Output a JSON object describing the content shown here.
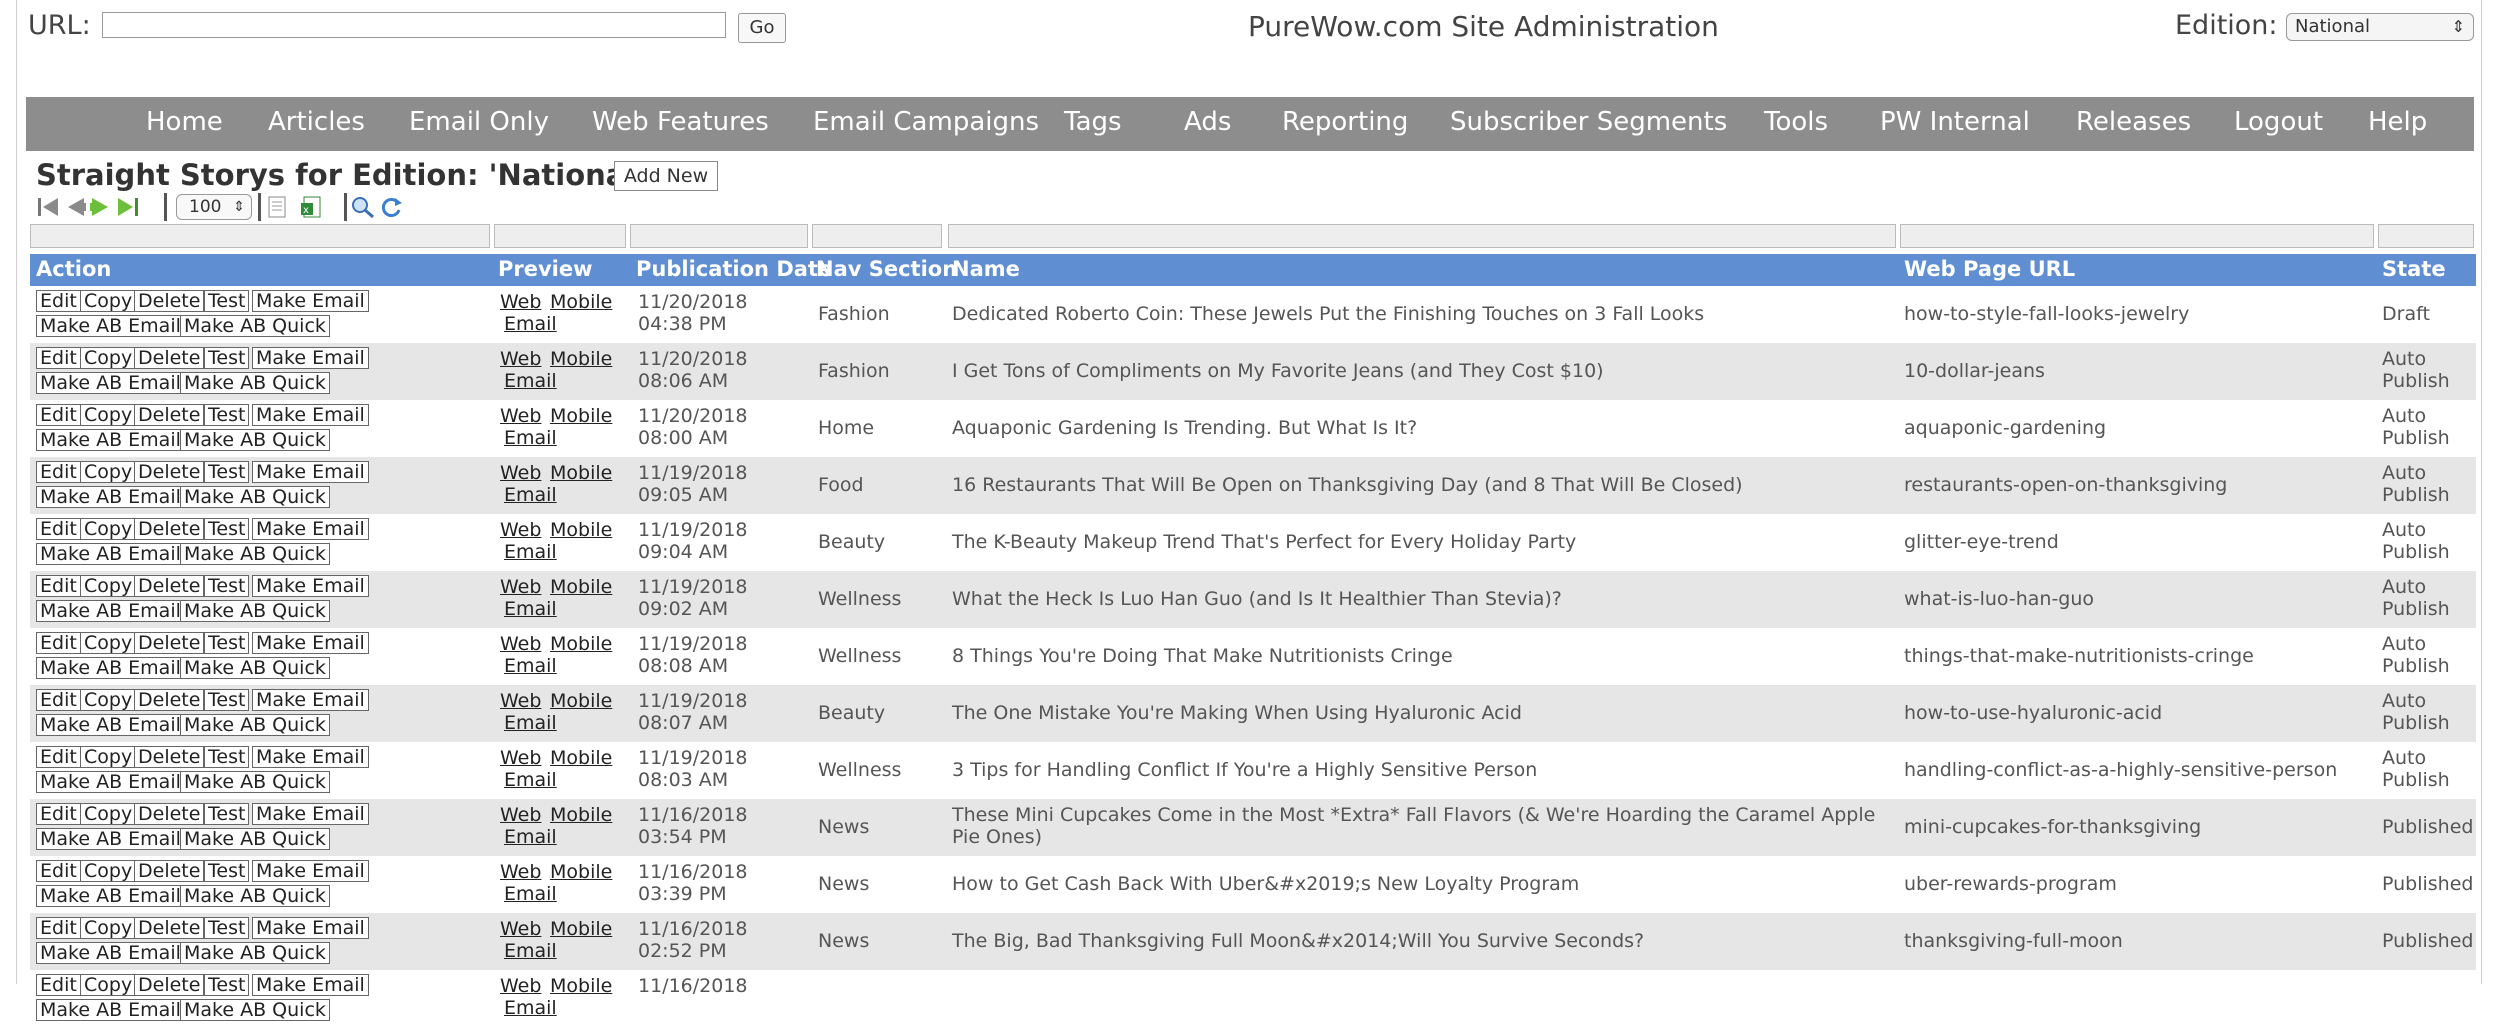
{
  "top": {
    "url_label": "URL:",
    "url_value": "",
    "go_label": "Go",
    "site_title": "PureWow.com Site Administration",
    "edition_label": "Edition:",
    "edition_value": "National"
  },
  "nav": {
    "items": [
      "Home",
      "Articles",
      "Email Only",
      "Web Features",
      "Email Campaigns",
      "Tags",
      "Ads",
      "Reporting",
      "Subscriber Segments",
      "Tools",
      "PW Internal",
      "Releases",
      "Logout",
      "Help"
    ]
  },
  "page": {
    "heading": "Straight Storys for Edition: 'National'",
    "add_new_label": "Add New",
    "page_size": "100"
  },
  "table": {
    "columns": [
      "Action",
      "Preview",
      "Publication Date",
      "Nav Section",
      "Name",
      "Web Page URL",
      "State"
    ],
    "action_labels": [
      "Edit",
      "Copy",
      "Delete",
      "Test",
      "Make Email",
      "Make AB Email",
      "Make AB Quick"
    ],
    "preview_labels": [
      "Web",
      "Mobile",
      "Email"
    ],
    "rows": [
      {
        "date": "11/20/2018",
        "time": "04:38 PM",
        "section": "Fashion",
        "name": "Dedicated Roberto Coin: These Jewels Put the Finishing Touches on 3 Fall Looks",
        "url": "how-to-style-fall-looks-jewelry",
        "state": "Draft"
      },
      {
        "date": "11/20/2018",
        "time": "08:06 AM",
        "section": "Fashion",
        "name": "I Get Tons of Compliments on My Favorite Jeans (and They Cost $10)",
        "url": "10-dollar-jeans",
        "state": "Auto Publish"
      },
      {
        "date": "11/20/2018",
        "time": "08:00 AM",
        "section": "Home",
        "name": "Aquaponic Gardening Is Trending. But What Is It?",
        "url": "aquaponic-gardening",
        "state": "Auto Publish"
      },
      {
        "date": "11/19/2018",
        "time": "09:05 AM",
        "section": "Food",
        "name": "16 Restaurants That Will Be Open on Thanksgiving Day (and 8 That Will Be Closed)",
        "url": "restaurants-open-on-thanksgiving",
        "state": "Auto Publish"
      },
      {
        "date": "11/19/2018",
        "time": "09:04 AM",
        "section": "Beauty",
        "name": "The K-Beauty Makeup Trend That's Perfect for Every Holiday Party",
        "url": "glitter-eye-trend",
        "state": "Auto Publish"
      },
      {
        "date": "11/19/2018",
        "time": "09:02 AM",
        "section": "Wellness",
        "name": "What the Heck Is Luo Han Guo (and Is It Healthier Than Stevia)?",
        "url": "what-is-luo-han-guo",
        "state": "Auto Publish"
      },
      {
        "date": "11/19/2018",
        "time": "08:08 AM",
        "section": "Wellness",
        "name": "8 Things You're Doing That Make Nutritionists Cringe",
        "url": "things-that-make-nutritionists-cringe",
        "state": "Auto Publish"
      },
      {
        "date": "11/19/2018",
        "time": "08:07 AM",
        "section": "Beauty",
        "name": "The One Mistake You're Making When Using Hyaluronic Acid",
        "url": "how-to-use-hyaluronic-acid",
        "state": "Auto Publish"
      },
      {
        "date": "11/19/2018",
        "time": "08:03 AM",
        "section": "Wellness",
        "name": "3 Tips for Handling Conflict If You're a Highly Sensitive Person",
        "url": "handling-conflict-as-a-highly-sensitive-person",
        "state": "Auto Publish"
      },
      {
        "date": "11/16/2018",
        "time": "03:54 PM",
        "section": "News",
        "name": "These Mini Cupcakes Come in the Most *Extra* Fall Flavors (& We're Hoarding the Caramel Apple Pie Ones)",
        "url": "mini-cupcakes-for-thanksgiving",
        "state": "Published"
      },
      {
        "date": "11/16/2018",
        "time": "03:39 PM",
        "section": "News",
        "name": "How to Get Cash Back With Uber&#x2019;s New Loyalty Program",
        "url": "uber-rewards-program",
        "state": "Published"
      },
      {
        "date": "11/16/2018",
        "time": "02:52 PM",
        "section": "News",
        "name": "The Big, Bad Thanksgiving Full Moon&#x2014;Will You Survive Seconds?",
        "url": "thanksgiving-full-moon",
        "state": "Published"
      }
    ],
    "partial_row": {
      "date": "11/16/2018"
    }
  },
  "colors": {
    "nav_bg": "#8d8d8d",
    "header_bg": "#5f8ed2",
    "alt_row_bg": "#e6e6e6"
  }
}
